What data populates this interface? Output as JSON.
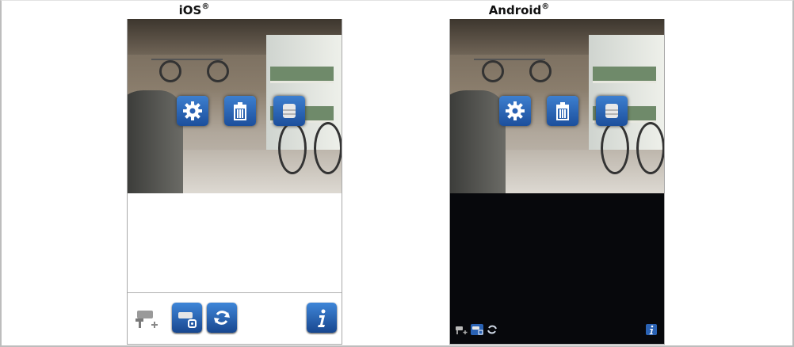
{
  "panels": {
    "ios": {
      "title": "iOS",
      "mark": "®"
    },
    "android": {
      "title": "Android",
      "mark": "®"
    }
  },
  "overlay_controls": [
    "gear-icon",
    "trash-icon",
    "storage-icon"
  ],
  "toolbar_icons": [
    "camera-add-icon",
    "camera-settings-icon",
    "refresh-icon",
    "info-icon"
  ],
  "colors": {
    "ios_background": "#ffffff",
    "android_background": "#07080c",
    "button_blue": "#2a62b4"
  }
}
